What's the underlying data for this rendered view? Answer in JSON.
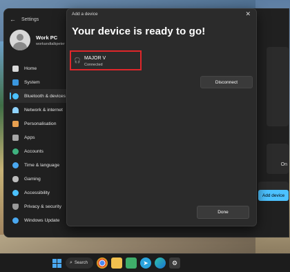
{
  "settings": {
    "title": "Settings",
    "profile": {
      "name": "Work PC",
      "email": "workandtalkpeter"
    },
    "nav": [
      {
        "label": "Home",
        "icon": "home-icon",
        "color": "#d9d9d9"
      },
      {
        "label": "System",
        "icon": "monitor-icon",
        "color": "#3a96dd"
      },
      {
        "label": "Bluetooth & devices",
        "icon": "bluetooth-icon",
        "color": "#4cc2ff"
      },
      {
        "label": "Network & internet",
        "icon": "wifi-icon",
        "color": "#8fd3ff"
      },
      {
        "label": "Personalisation",
        "icon": "brush-icon",
        "color": "#e8a050"
      },
      {
        "label": "Apps",
        "icon": "apps-icon",
        "color": "#a7a7a7"
      },
      {
        "label": "Accounts",
        "icon": "person-icon",
        "color": "#3fb27f"
      },
      {
        "label": "Time & language",
        "icon": "globe-clock-icon",
        "color": "#4aa8f0"
      },
      {
        "label": "Gaming",
        "icon": "gamepad-icon",
        "color": "#bdbdbd"
      },
      {
        "label": "Accessibility",
        "icon": "accessibility-icon",
        "color": "#4cc2ff"
      },
      {
        "label": "Privacy & security",
        "icon": "shield-icon",
        "color": "#9a9a9a"
      },
      {
        "label": "Windows Update",
        "icon": "update-icon",
        "color": "#4aa8f0"
      }
    ],
    "active_index": 2,
    "on_label": "On",
    "add_device_label": "Add device"
  },
  "dialog": {
    "title": "Add a device",
    "heading": "Your device is ready to go!",
    "device": {
      "name": "MAJOR V",
      "status": "Connected",
      "icon": "headphones-icon"
    },
    "disconnect_label": "Disconnect",
    "done_label": "Done"
  },
  "taskbar": {
    "search_label": "Search",
    "icons": [
      "start-icon",
      "search-icon",
      "chrome-icon",
      "file-explorer-icon",
      "notepad-icon",
      "telegram-icon",
      "edge-icon",
      "settings-gear-icon"
    ]
  }
}
